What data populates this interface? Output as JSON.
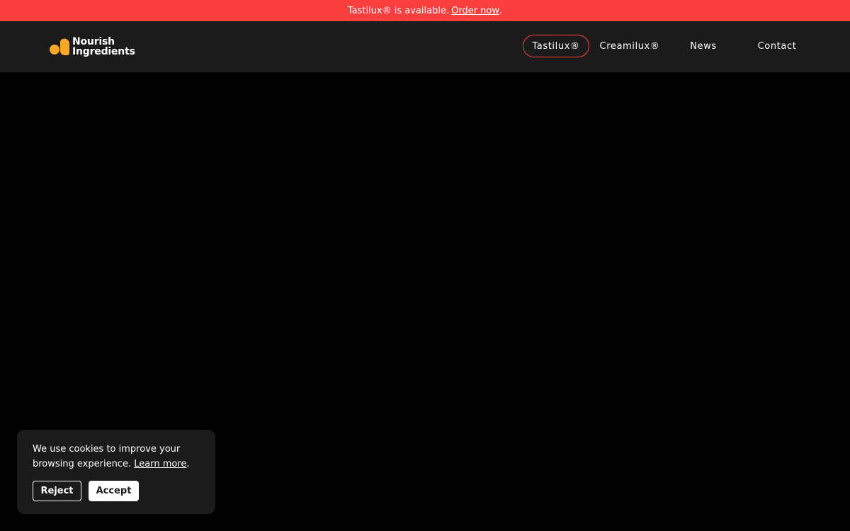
{
  "announcement": {
    "text": "Tastilux® is available.",
    "link_label": "Order now",
    "suffix": "."
  },
  "brand": {
    "line1": "Nourish",
    "line2": "Ingredients",
    "logo_color": "#f9a825"
  },
  "nav": {
    "items": [
      {
        "label": "Tastilux®",
        "active": true
      },
      {
        "label": "Creamilux®",
        "active": false
      },
      {
        "label": "News",
        "active": false
      },
      {
        "label": "Contact",
        "active": false
      }
    ]
  },
  "cookie": {
    "text": "We use cookies to improve your browsing experience.",
    "link_label": "Learn more",
    "suffix": ".",
    "reject_label": "Reject",
    "accept_label": "Accept"
  },
  "colors": {
    "accent": "#fb3e3e",
    "header_bg": "#1b1b1b",
    "page_bg": "#000000"
  }
}
